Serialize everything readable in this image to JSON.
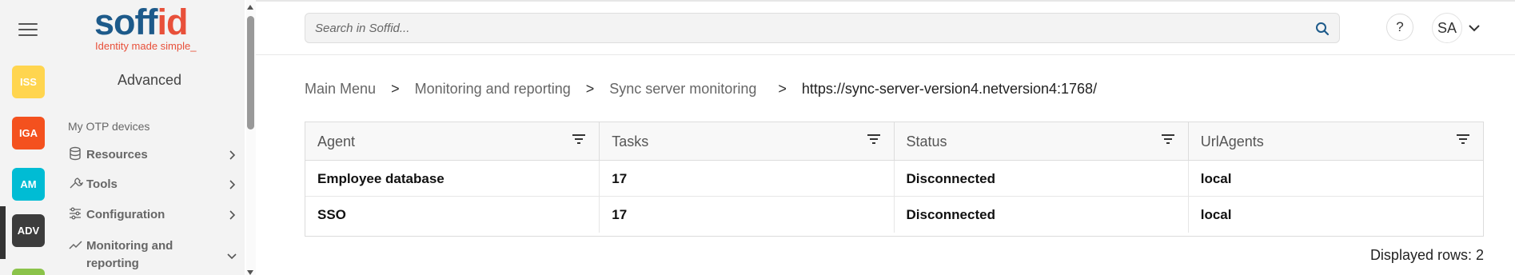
{
  "apps": [
    {
      "code": "ISS",
      "color": "#ffd54f",
      "text_color": "#ffffff"
    },
    {
      "code": "IGA",
      "color": "#f4511e",
      "text_color": "#ffffff"
    },
    {
      "code": "AM",
      "color": "#00bcd4",
      "text_color": "#ffffff"
    },
    {
      "code": "ADV",
      "color": "#3c3c3c",
      "text_color": "#ffffff"
    }
  ],
  "brand": {
    "name_part1": "soff",
    "name_part2": "id",
    "tagline": "Identity made simple_",
    "primary_color": "#1d5a8a",
    "accent_color": "#e8503a"
  },
  "sidebar": {
    "title": "Advanced",
    "plain_item": "My OTP devices",
    "items": [
      {
        "label": "Resources",
        "icon": "database-icon",
        "expanded": false
      },
      {
        "label": "Tools",
        "icon": "wrench-icon",
        "expanded": false
      },
      {
        "label": "Configuration",
        "icon": "sliders-icon",
        "expanded": false
      },
      {
        "label": "Monitoring and reporting",
        "icon": "chart-line-icon",
        "expanded": true
      }
    ]
  },
  "header": {
    "search_placeholder": "Search in Soffid...",
    "help_label": "?",
    "user_initials": "SA"
  },
  "breadcrumb": {
    "items": [
      "Main Menu",
      "Monitoring and reporting",
      "Sync server monitoring"
    ],
    "separator": ">",
    "current": "https://sync-server-version4.netversion4:1768/"
  },
  "grid": {
    "columns": [
      "Agent",
      "Tasks",
      "Status",
      "UrlAgents"
    ],
    "rows": [
      [
        "Employee database",
        "17",
        "Disconnected",
        "local"
      ],
      [
        "SSO",
        "17",
        "Disconnected",
        "local"
      ]
    ],
    "footer": "Displayed rows: 2"
  }
}
